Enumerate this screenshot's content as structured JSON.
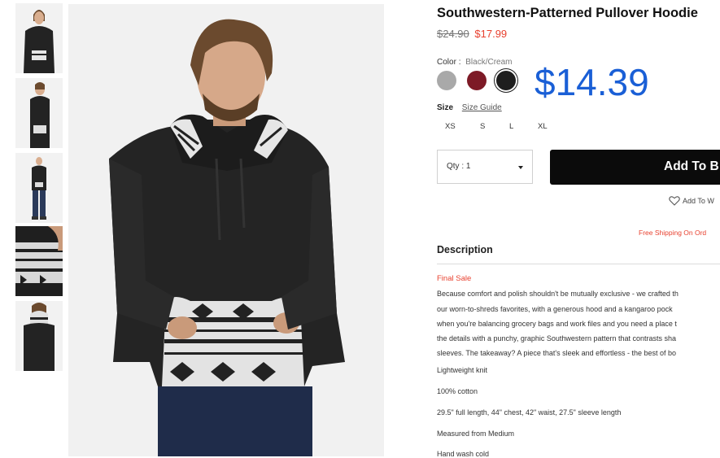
{
  "product": {
    "title": "Southwestern-Patterned Pullover Hoodie",
    "original_price": "$24.90",
    "sale_price": "$17.99",
    "promo_price": "$14.39",
    "promo_color": "#1a5fd6",
    "sale_color": "#e8412f"
  },
  "color": {
    "label": "Color",
    "separator": ":",
    "value": "Black/Cream",
    "swatches": [
      {
        "name": "heather-gray",
        "hex": "#a9a9a9"
      },
      {
        "name": "burgundy",
        "hex": "#7d1a26"
      },
      {
        "name": "black",
        "hex": "#1e1e1e",
        "selected": true
      }
    ]
  },
  "size": {
    "label": "Size",
    "guide_link": "Size Guide",
    "options": [
      "XS",
      "S",
      "L",
      "XL"
    ]
  },
  "quantity": {
    "label": "Qty : 1",
    "icon": "caret-down-icon"
  },
  "actions": {
    "add_to_bag": "Add To B",
    "wishlist": "Add To W",
    "wishlist_icon": "heart-outline-icon"
  },
  "shipping_note": "Free Shipping On Ord",
  "description": {
    "heading": "Description",
    "final_sale": "Final Sale",
    "paragraph_lines": [
      "Because comfort and polish shouldn't be mutually exclusive - we crafted th",
      "our worn-to-shreds favorites, with a generous hood and a kangaroo pock",
      "when you're balancing grocery bags and work files and you need a place t",
      "the details with a punchy, graphic Southwestern pattern that contrasts sha",
      "sleeves. The takeaway? A piece that's sleek and effortless - the best of bo"
    ],
    "details": [
      "Lightweight knit",
      "100% cotton",
      "29.5\" full length, 44\" chest, 42\" waist, 27.5\" sleeve length",
      "Measured from Medium",
      "Hand wash cold"
    ]
  },
  "gallery": {
    "thumbnails": [
      "thumb-front",
      "thumb-side",
      "thumb-full-body",
      "thumb-pocket-detail",
      "thumb-back"
    ],
    "main_image": "model-wearing-hoodie-front"
  }
}
